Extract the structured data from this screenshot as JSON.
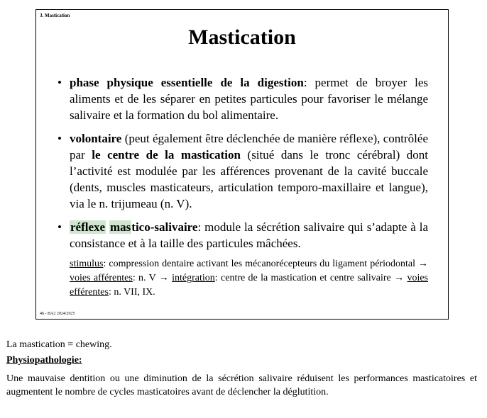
{
  "slide": {
    "header": "3. Mastication",
    "title": "Mastication",
    "footer": "46 - BA2 2024/2025",
    "bullets": [
      {
        "bold": "phase physique essentielle de la digestion",
        "text": ": permet de broyer les aliments et de les séparer en petites particules pour favoriser le mélange salivaire et la formation du bol alimentaire."
      },
      {
        "bold1": "volontaire",
        "text1": " (peut également être déclenchée de manière réflexe), contrôlée par ",
        "bold2": "le centre de la mastication",
        "text2": " (situé dans le tronc cérébral) dont l’activité est modulée par les afférences provenant de la cavité buccale (dents, muscles masticateurs, articulation temporo-maxillaire et langue), via le n. trijumeau (n. V)."
      },
      {
        "bold_hl1": "réflexe",
        "bold_hl2": "mas",
        "bold_rest": "tico-salivaire",
        "text": ": module la sécrétion salivaire qui s’adapte à la consistance et à la taille des particules mâchées."
      }
    ],
    "sub": {
      "stimulus_label": "stimulus",
      "stimulus_text": ": compression dentaire activant les mécanorécepteurs du ligament périodontal → ",
      "aff_label": "voies afférentes",
      "aff_text": ": n. V → ",
      "int_label": "intégration",
      "int_text": ": centre de la mastication et centre salivaire → ",
      "eff_label": "voies efférentes",
      "eff_text": ": n. VII, IX."
    }
  },
  "notes": {
    "definition": "La mastication  = chewing.",
    "physio_heading": "Physiopathologie:",
    "paragraph": "Une mauvaise dentition ou une diminution de la sécrétion salivaire réduisent les performances masticatoires et augmentent le nombre de cycles masticatoires avant de déclencher la déglutition."
  }
}
